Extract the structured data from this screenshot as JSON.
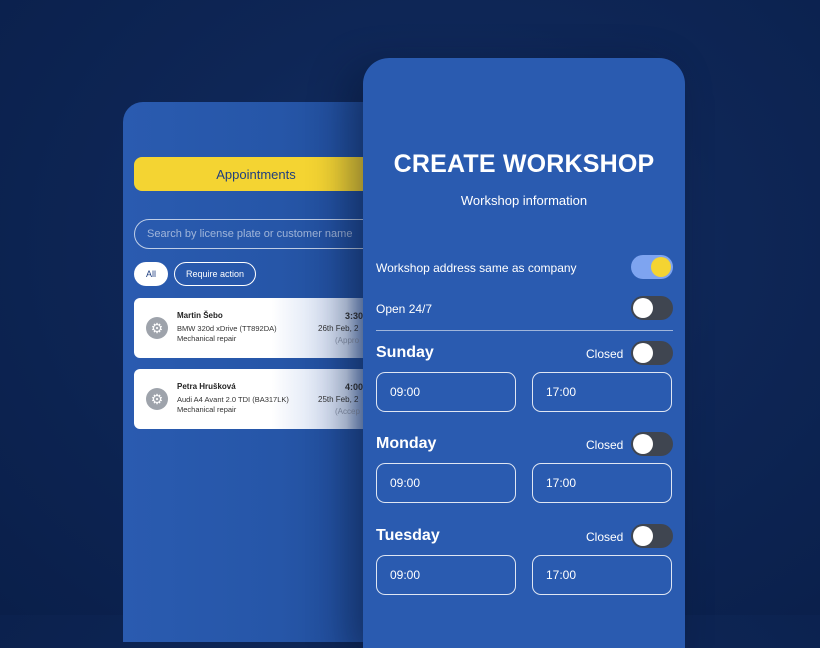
{
  "appointments": {
    "button_label": "Appointments",
    "search_placeholder": "Search by license plate or customer name",
    "filters": [
      "All",
      "Require action"
    ],
    "cards": [
      {
        "name": "Martin Šebo",
        "car": "BMW 320d xDrive (TT892DA)",
        "service": "Mechanical repair",
        "time": "3:30",
        "date": "26th Feb, 2",
        "status": "(Appro"
      },
      {
        "name": "Petra Hrušková",
        "car": "Audi A4 Avant 2.0 TDI (BA317LK)",
        "service": "Mechanical repair",
        "time": "4:00",
        "date": "25th Feb, 2",
        "status": "(Accep"
      }
    ],
    "icon": "gear-icon"
  },
  "workshop": {
    "title": "CREATE WORKSHOP",
    "subtitle": "Workshop information",
    "same_address_label": "Workshop address same as company",
    "same_address_on": true,
    "open_247_label": "Open 24/7",
    "open_247_on": false,
    "days": [
      {
        "name": "Sunday",
        "closed_label": "Closed",
        "closed_on": false,
        "open": "09:00",
        "close": "17:00"
      },
      {
        "name": "Monday",
        "closed_label": "Closed",
        "closed_on": false,
        "open": "09:00",
        "close": "17:00"
      },
      {
        "name": "Tuesday",
        "closed_label": "Closed",
        "closed_on": false,
        "open": "09:00",
        "close": "17:00"
      }
    ]
  },
  "colors": {
    "background": "#0e2656",
    "panel": "#2a5bb0",
    "accent_yellow": "#f4d432",
    "toggle_off": "#3f4550",
    "toggle_on_track": "#7ea4f0"
  }
}
